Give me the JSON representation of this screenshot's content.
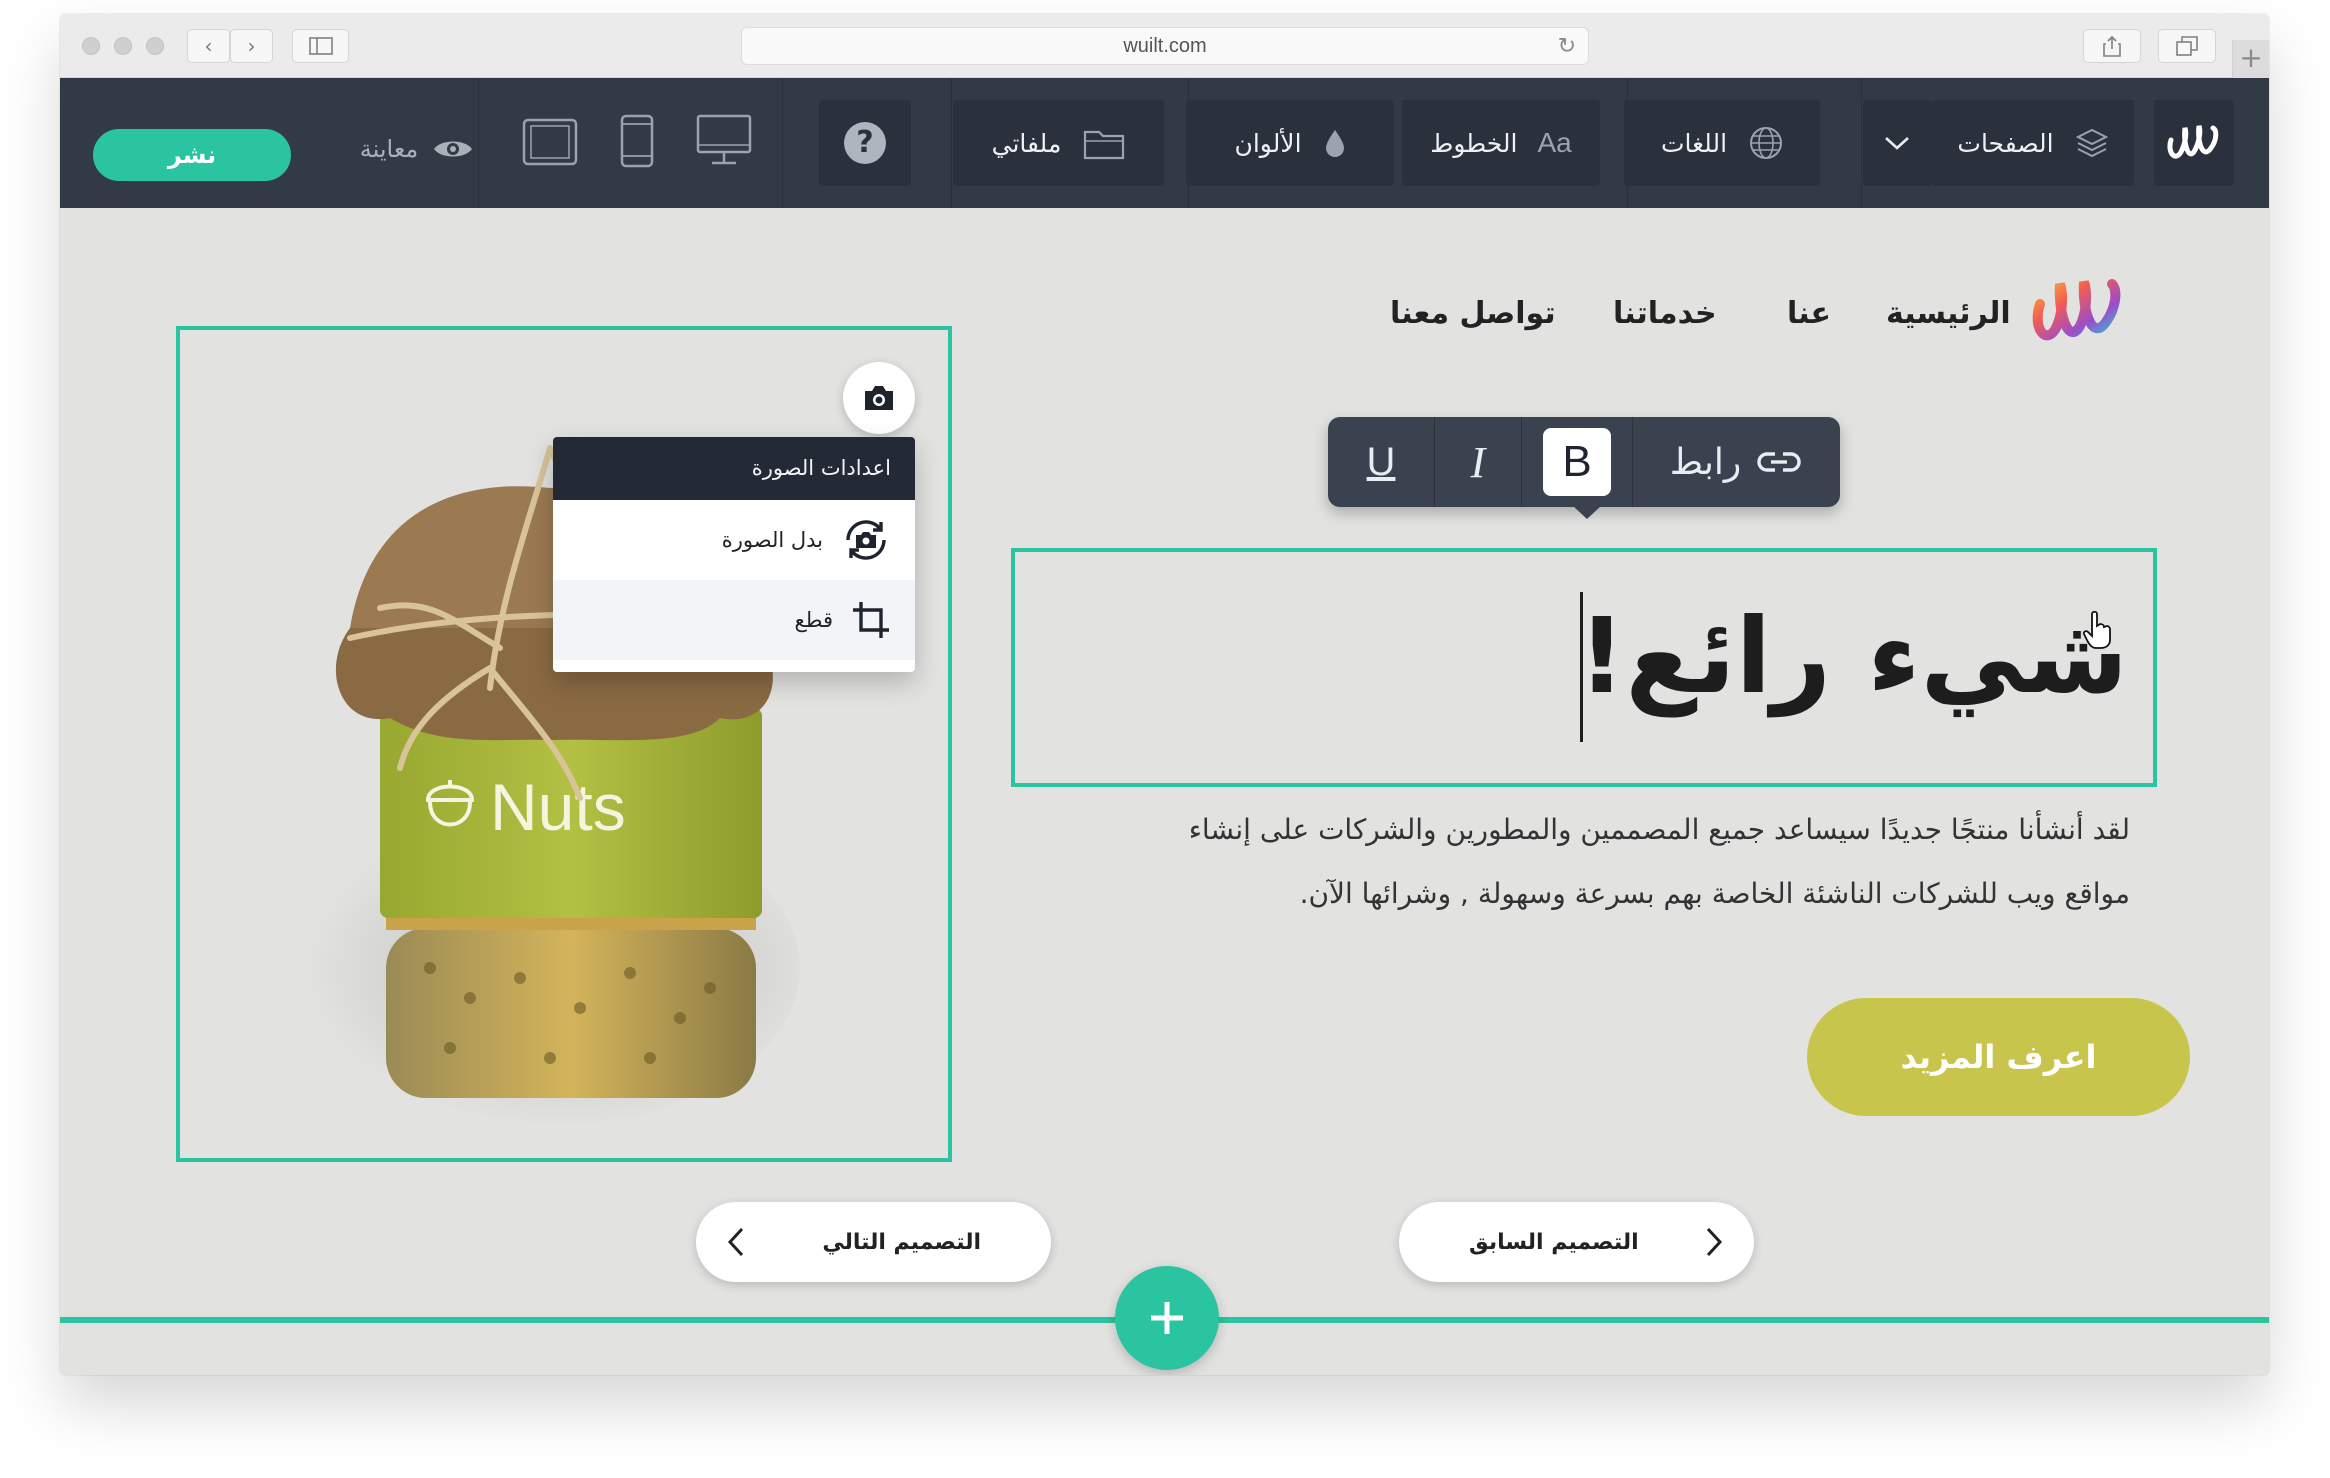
{
  "browser": {
    "url": "wuilt.com"
  },
  "toolbar": {
    "publish_label": "نشر",
    "preview_label": "معاينة",
    "files_label": "ملفاتي",
    "colors_label": "الألوان",
    "fonts_label": "الخطوط",
    "fonts_icon_text": "Aa",
    "languages_label": "اللغات",
    "pages_label": "الصفحات",
    "help_symbol": "?"
  },
  "site": {
    "nav": [
      "الرئيسية",
      "عنا",
      "خدماتنا",
      "تواصل معنا"
    ],
    "headline": "شيء رائع!",
    "paragraph_line1": "لقد أنشأنا منتجًا جديدًا سيساعد جميع المصممين والمطورين والشركات على إنشاء",
    "paragraph_line2": "مواقع ويب للشركات الناشئة الخاصة بهم بسرعة وسهولة , وشرائها الآن.",
    "cta_label": "اعرف المزيد",
    "jar_label": "Nuts"
  },
  "format_toolbar": {
    "link_label": "رابط",
    "bold": "B",
    "italic": "I",
    "underline": "U"
  },
  "image_menu": {
    "title": "اعدادات الصورة",
    "replace": "بدل الصورة",
    "crop": "قطع"
  },
  "design_nav": {
    "next_label": "التصميم التالي",
    "prev_label": "التصميم السابق"
  },
  "colors": {
    "accent": "#2bc4a0",
    "toolbar_bg": "#323a46",
    "cta": "#c8c54d",
    "jar_label": "#aebd3a"
  }
}
